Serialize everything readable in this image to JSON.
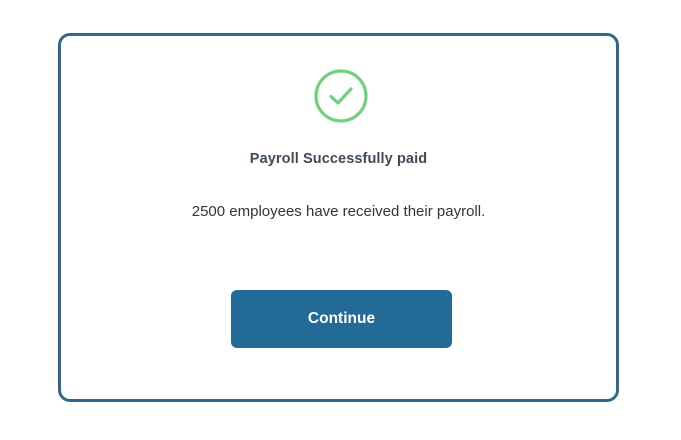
{
  "dialog": {
    "icon": "check-circle-icon",
    "title": "Payroll Successfully paid",
    "message": "2500 employees have received their payroll.",
    "continue_label": "Continue"
  },
  "colors": {
    "border": "#2e6a8e",
    "success": "#6fd27a",
    "button": "#236a96",
    "title_text": "#3f4a58",
    "body_text": "#2f3640"
  }
}
